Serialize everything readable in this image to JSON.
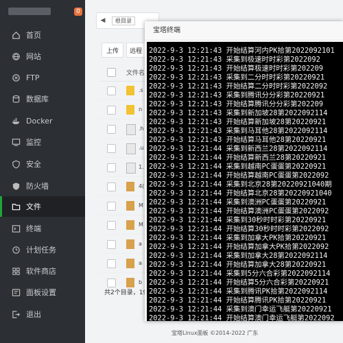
{
  "sidebar": {
    "badge": "0",
    "items": [
      {
        "label": "首页",
        "icon": "home-icon"
      },
      {
        "label": "网站",
        "icon": "globe-icon"
      },
      {
        "label": "FTP",
        "icon": "ftp-icon"
      },
      {
        "label": "数据库",
        "icon": "database-icon"
      },
      {
        "label": "Docker",
        "icon": "docker-icon"
      },
      {
        "label": "监控",
        "icon": "monitor-icon"
      },
      {
        "label": "安全",
        "icon": "shield-icon"
      },
      {
        "label": "防火墙",
        "icon": "firewall-icon"
      },
      {
        "label": "文件",
        "icon": "folder-icon",
        "active": true
      },
      {
        "label": "终端",
        "icon": "terminal-icon"
      },
      {
        "label": "计划任务",
        "icon": "clock-icon"
      },
      {
        "label": "软件商店",
        "icon": "grid-icon"
      },
      {
        "label": "面板设置",
        "icon": "settings-icon"
      },
      {
        "label": "退出",
        "icon": "logout-icon"
      }
    ]
  },
  "file_manager": {
    "breadcrumb_label": "根目录",
    "upload_label": "上传",
    "remote_label": "远程",
    "column_filename": "文件名",
    "rows": [
      {
        "name": ".s",
        "type": "folder"
      },
      {
        "name": "n",
        "type": "folder"
      },
      {
        "name": ".h",
        "type": "file"
      },
      {
        "name": ".u",
        "type": "file"
      },
      {
        "name": "1.",
        "type": "file"
      },
      {
        "name": "4(",
        "type": "package"
      },
      {
        "name": "M",
        "type": "package"
      },
      {
        "name": "M",
        "type": "package"
      },
      {
        "name": "a",
        "type": "package"
      },
      {
        "name": "a",
        "type": "package"
      },
      {
        "name": "b",
        "type": "package"
      }
    ],
    "summary": "共2个目录，19"
  },
  "footer": "宝塔Linux面板 ©2014-2022 广东",
  "terminal": {
    "title": "宝塔终端",
    "lines": [
      "2022-9-3 12:21:43 开始结算河内PK拾第2022092101",
      "2022-9-3 12:21:43 采集到极速时时彩第2022092",
      "2022-9-3 12:21:43 开始结算极速时时彩第202209",
      "2022-9-3 12:21:43 采集到二分时时彩第20220921",
      "2022-9-3 12:21:43 开始结算二分时时彩第2022092",
      "2022-9-3 12:21:43 采集到腾讯分分彩第20220921",
      "2022-9-3 12:21:43 开始结算腾讯分分彩第202209",
      "2022-9-3 12:21:43 采集到新加坡28第2022092114",
      "2022-9-3 12:21:43 开始结算新加坡28第20220921",
      "2022-9-3 12:21:43 采集到马耳他28第2022092114",
      "2022-9-3 12:21:43 开始结算马耳他28第20220921",
      "2022-9-3 12:21:44 采集到新西兰28第2022092114",
      "2022-9-3 12:21:44 开始结算新西兰28第20220921",
      "2022-9-3 12:21:44 采集到越南PC蛋蛋第20220921",
      "2022-9-3 12:21:44 开始结算越南PC蛋蛋第2022092",
      "2022-9-3 12:21:44 采集到北京28第20220921040期",
      "2022-9-3 12:21:44 开始结算北京28第20220921040",
      "2022-9-3 12:21:44 采集到澳洲PC蛋蛋第20220921",
      "2022-9-3 12:21:44 开始结算澳洲PC蛋蛋第2022092",
      "2022-9-3 12:21:44 采集到30秒时时彩第20220921",
      "2022-9-3 12:21:44 开始结算30秒时时彩第2022092",
      "2022-9-3 12:21:44 采集到加拿大PK拾第20220921",
      "2022-9-3 12:21:44 开始结算加拿大PK拾第2022092",
      "2022-9-3 12:21:44 采集到加拿大28第2022092114",
      "2022-9-3 12:21:44 开始结算加拿大28第20220921",
      "2022-9-3 12:21:44 采集到5分六合彩第2022092114",
      "2022-9-3 12:21:44 开始结算5分六合彩第20220921",
      "2022-9-3 12:21:44 采集到腾讯PK拾第2022092114",
      "2022-9-3 12:21:44 开始结算腾讯PK拾第20220921",
      "2022-9-3 12:21:44 采集到澳门幸运飞艇第20220921",
      "2022-9-3 12:21:44 开始结算澳门幸运飞艇第2022092"
    ]
  },
  "colors": {
    "sidebar_bg": "#2c2f33",
    "accent": "#20a53a",
    "badge": "#e8733c",
    "terminal_bg": "#000000"
  }
}
